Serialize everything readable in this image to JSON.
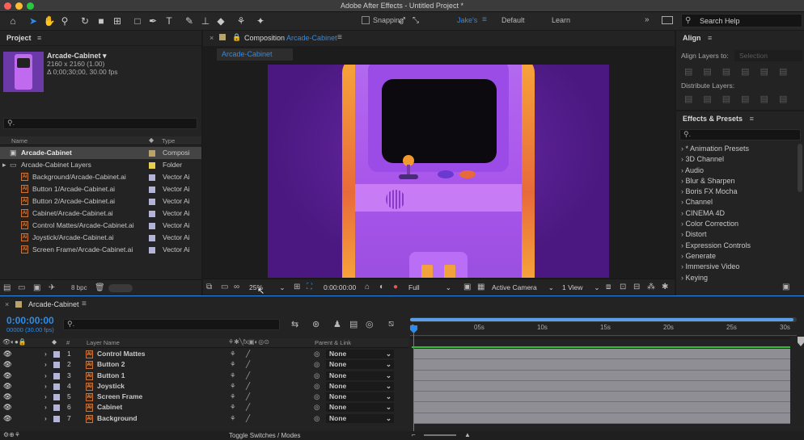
{
  "window": {
    "title": "Adobe After Effects - Untitled Project *"
  },
  "toolbar": {
    "snapping_label": "Snapping",
    "workspaces": [
      "Jake's",
      "Default",
      "Learn"
    ],
    "search_help": "Search Help"
  },
  "project": {
    "panel_title": "Project",
    "comp_name": "Arcade-Cabinet",
    "comp_size": "2160 x 2160 (1.00)",
    "comp_duration": "Δ 0;00;30;00, 30.00 fps",
    "col_name": "Name",
    "col_type": "Type",
    "items": [
      {
        "name": "Arcade-Cabinet",
        "type": "Composi",
        "color": "#b9a36a",
        "selected": true
      },
      {
        "name": "Arcade-Cabinet Layers",
        "type": "Folder",
        "color": "#e6cf4f"
      },
      {
        "name": "Background/Arcade-Cabinet.ai",
        "type": "Vector Ai",
        "color": "#b4b4d8"
      },
      {
        "name": "Button 1/Arcade-Cabinet.ai",
        "type": "Vector Ai",
        "color": "#b4b4d8"
      },
      {
        "name": "Button 2/Arcade-Cabinet.ai",
        "type": "Vector Ai",
        "color": "#b4b4d8"
      },
      {
        "name": "Cabinet/Arcade-Cabinet.ai",
        "type": "Vector Ai",
        "color": "#b4b4d8"
      },
      {
        "name": "Control Mattes/Arcade-Cabinet.ai",
        "type": "Vector Ai",
        "color": "#b4b4d8"
      },
      {
        "name": "Joystick/Arcade-Cabinet.ai",
        "type": "Vector Ai",
        "color": "#b4b4d8"
      },
      {
        "name": "Screen Frame/Arcade-Cabinet.ai",
        "type": "Vector Ai",
        "color": "#b4b4d8"
      }
    ],
    "bpc": "8 bpc"
  },
  "composition": {
    "panel_title_prefix": "Composition",
    "panel_title_name": "Arcade-Cabinet",
    "tab": "Arcade-Cabinet",
    "zoom": "25%",
    "timecode": "0:00:00:00",
    "resolution": "Full",
    "camera": "Active Camera",
    "views": "1 View"
  },
  "align": {
    "panel_title": "Align",
    "align_layers_to": "Align Layers to:",
    "align_target": "Selection",
    "distribute_layers": "Distribute Layers:"
  },
  "effects": {
    "panel_title": "Effects & Presets",
    "items": [
      "* Animation Presets",
      "3D Channel",
      "Audio",
      "Blur & Sharpen",
      "Boris FX Mocha",
      "Channel",
      "CINEMA 4D",
      "Color Correction",
      "Distort",
      "Expression Controls",
      "Generate",
      "Immersive Video",
      "Keying"
    ]
  },
  "timeline": {
    "tab": "Arcade-Cabinet",
    "timecode": "0:00:00:00",
    "frame_info": "00000 (30.00 fps)",
    "col_num": "#",
    "col_layer_name": "Layer Name",
    "col_parent": "Parent & Link",
    "layers": [
      {
        "num": "1",
        "name": "Control Mattes",
        "parent": "None"
      },
      {
        "num": "2",
        "name": "Button 2",
        "parent": "None"
      },
      {
        "num": "3",
        "name": "Button 1",
        "parent": "None"
      },
      {
        "num": "4",
        "name": "Joystick",
        "parent": "None"
      },
      {
        "num": "5",
        "name": "Screen Frame",
        "parent": "None"
      },
      {
        "num": "6",
        "name": "Cabinet",
        "parent": "None"
      },
      {
        "num": "7",
        "name": "Background",
        "parent": "None"
      }
    ],
    "ruler": [
      "0s",
      "05s",
      "10s",
      "15s",
      "20s",
      "25s",
      "30s"
    ],
    "toggle_label": "Toggle Switches / Modes"
  },
  "colors": {
    "accent": "#2d8ceb",
    "layer_label": "#b4b4d8",
    "cabinet_purple": "#9a4fe0"
  }
}
